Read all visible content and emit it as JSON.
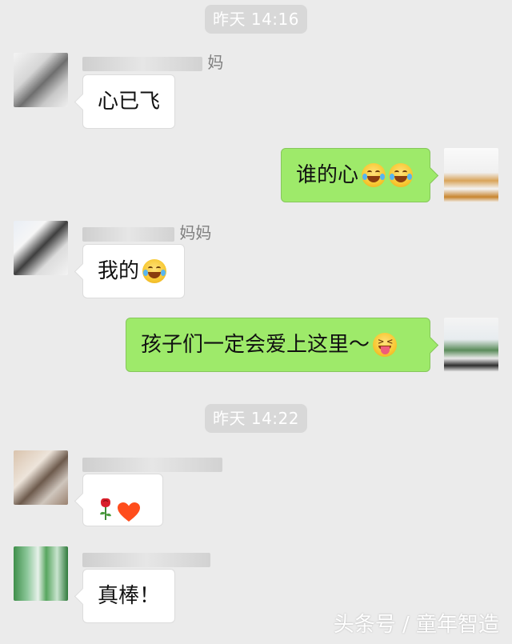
{
  "timestamps": [
    "昨天 14:16",
    "昨天 14:22"
  ],
  "messages": [
    {
      "side": "left",
      "sender": "妈",
      "text": "心已飞",
      "emoji": []
    },
    {
      "side": "right",
      "text": "谁的心",
      "emoji": [
        "laughing-crying-emoji",
        "laughing-crying-emoji"
      ]
    },
    {
      "side": "left",
      "sender": "妈妈",
      "text": "我的",
      "emoji": [
        "laughing-crying-emoji"
      ]
    },
    {
      "side": "right",
      "text": "孩子们一定会爱上这里～",
      "emoji": [
        "squinting-tongue-emoji"
      ]
    },
    {
      "side": "left",
      "sender": "",
      "text": "",
      "emoji": [
        "rose-emoji",
        "heart-emoji"
      ]
    },
    {
      "side": "left",
      "sender": "",
      "text": "真棒！",
      "emoji": []
    }
  ],
  "watermark": "头条号 / 童年智造",
  "colors": {
    "background": "#ebebeb",
    "bubble_left": "#ffffff",
    "bubble_right": "#9eea6a",
    "time_pill": "#d8d8d8"
  }
}
